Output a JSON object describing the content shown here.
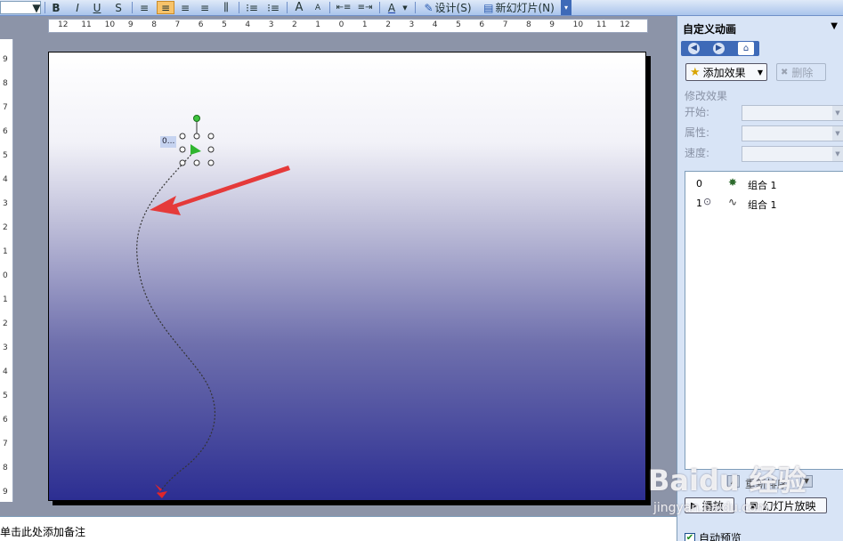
{
  "toolbar": {
    "buttons": [
      {
        "label": "B"
      },
      {
        "label": "I"
      },
      {
        "label": "U"
      },
      {
        "label": "S"
      },
      {
        "label": "≡"
      },
      {
        "label": "≡"
      },
      {
        "label": "≡"
      },
      {
        "label": "≡"
      },
      {
        "label": "⫼"
      },
      {
        "label": "⁝≡"
      },
      {
        "label": "⁝≡"
      },
      {
        "label": "A"
      },
      {
        "label": "A"
      },
      {
        "label": "⇤≡"
      },
      {
        "label": "≡⇥"
      },
      {
        "label": "A"
      }
    ],
    "design_label": "设计(S)",
    "new_slide_label": "新幻灯片(N)"
  },
  "ruler": {
    "h_numbers": [
      "12",
      "11",
      "10",
      "9",
      "8",
      "7",
      "6",
      "5",
      "4",
      "3",
      "2",
      "1",
      "0",
      "1",
      "2",
      "3",
      "4",
      "5",
      "6",
      "7",
      "8",
      "9",
      "10",
      "11",
      "12"
    ],
    "v_numbers": [
      "9",
      "8",
      "7",
      "6",
      "5",
      "4",
      "3",
      "2",
      "1",
      "0",
      "1",
      "2",
      "3",
      "4",
      "5",
      "6",
      "7",
      "8",
      "9"
    ]
  },
  "slide": {
    "object_label": "0..."
  },
  "notes": {
    "placeholder": "单击此处添加备注"
  },
  "task_pane": {
    "title": "自定义动画",
    "add_effect_label": "添加效果",
    "delete_label": "删除",
    "modify_heading": "修改效果",
    "start_label": "开始:",
    "property_label": "属性:",
    "speed_label": "速度:",
    "effects": [
      {
        "index": "0",
        "trigger": "",
        "icon": "star-effect-icon",
        "name": "组合 1"
      },
      {
        "index": "1",
        "trigger": "mouse-click",
        "icon": "motion-path-icon",
        "name": "组合 1"
      }
    ],
    "reorder_label": "重新排序",
    "play_label": "播放",
    "slideshow_label": "幻灯片放映",
    "autopreview_label": "自动预览",
    "autopreview_checked": true
  },
  "watermark": {
    "line1": "Baidu 经验",
    "line2": "jingyan.baidu.com"
  },
  "colors": {
    "arrow": "#e53a3a",
    "motion_path": "#333333",
    "pane_background": "#d8e4f6",
    "slide_gradient_bottom": "#2c2e92"
  }
}
